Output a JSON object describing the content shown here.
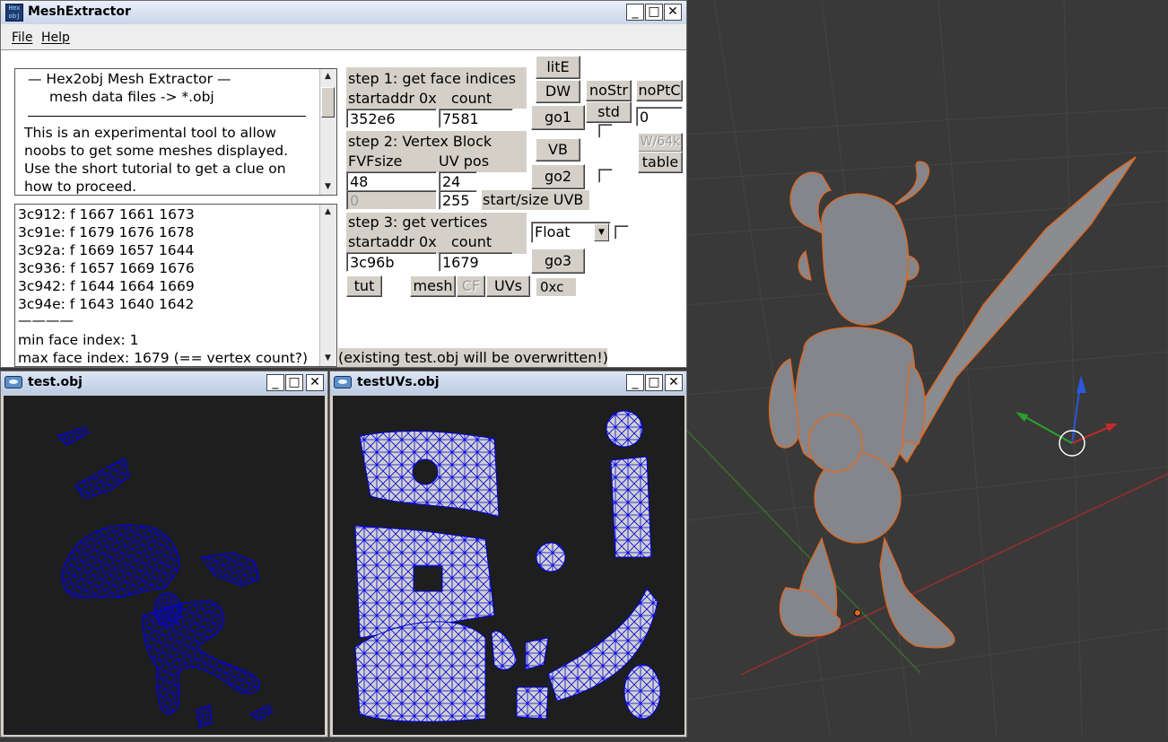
{
  "main_window": {
    "title": "MeshExtractor",
    "icon_text": "H≡x obj",
    "menu": [
      "File",
      "Help"
    ],
    "info_lines": [
      "—  Hex2obj Mesh Extractor  —",
      "mesh data files -> *.obj",
      "This is an experimental tool to allow",
      "noobs to get some meshes displayed.",
      "Use the short tutorial to get a clue on",
      "how to proceed."
    ],
    "log_lines": [
      "3c912: f  1667 1661 1673",
      "3c91e: f  1679 1676 1678",
      "3c92a: f  1669 1657 1644",
      "3c936: f  1657 1669 1676",
      "3c942: f  1644 1664 1669",
      "3c94e: f  1643 1640 1642",
      "————",
      "min face index: 1",
      "max face index: 1679 (== vertex count?)"
    ],
    "step1": {
      "title": "step 1: get face indices",
      "addr_label": "startaddr 0x",
      "count_label": "count",
      "addr": "352e6",
      "count": "7581"
    },
    "step2": {
      "title": "step 2: Vertex Block",
      "fvf_label": "FVFsize",
      "uv_label": "UV pos",
      "fvf": "48",
      "uv": "24",
      "uvb_start": "0",
      "uvb_size": "255",
      "uvb_label": "start/size UVB"
    },
    "step3": {
      "title": "step 3: get vertices",
      "addr_label": "startaddr 0x",
      "count_label": "count",
      "addr": "3c96b",
      "count": "1679",
      "type": "Float"
    },
    "buttons": {
      "lite": "litE",
      "dw": "DW",
      "nostr": "noStr",
      "noptc": "noPtC",
      "std": "std",
      "go1": "go1",
      "vb": "VB",
      "w64k": "W/64k",
      "table": "table",
      "go2": "go2",
      "go3": "go3",
      "tut": "tut",
      "mesh": "mesh",
      "cf": "CF",
      "uvs": "UVs"
    },
    "side_value": "0",
    "offset_label": "0xc",
    "warning": "(existing test.obj will be overwritten!)"
  },
  "test_window": {
    "title": "test.obj"
  },
  "uv_window": {
    "title": "testUVs.obj"
  },
  "colors": {
    "wire": "#0000e0",
    "uv_fill": "#d0d0d0",
    "mesh_grey": "#7d7f84",
    "outline": "#e06020"
  },
  "icons": {
    "minimize": "minimize-icon",
    "maximize": "maximize-icon",
    "close": "close-icon"
  }
}
